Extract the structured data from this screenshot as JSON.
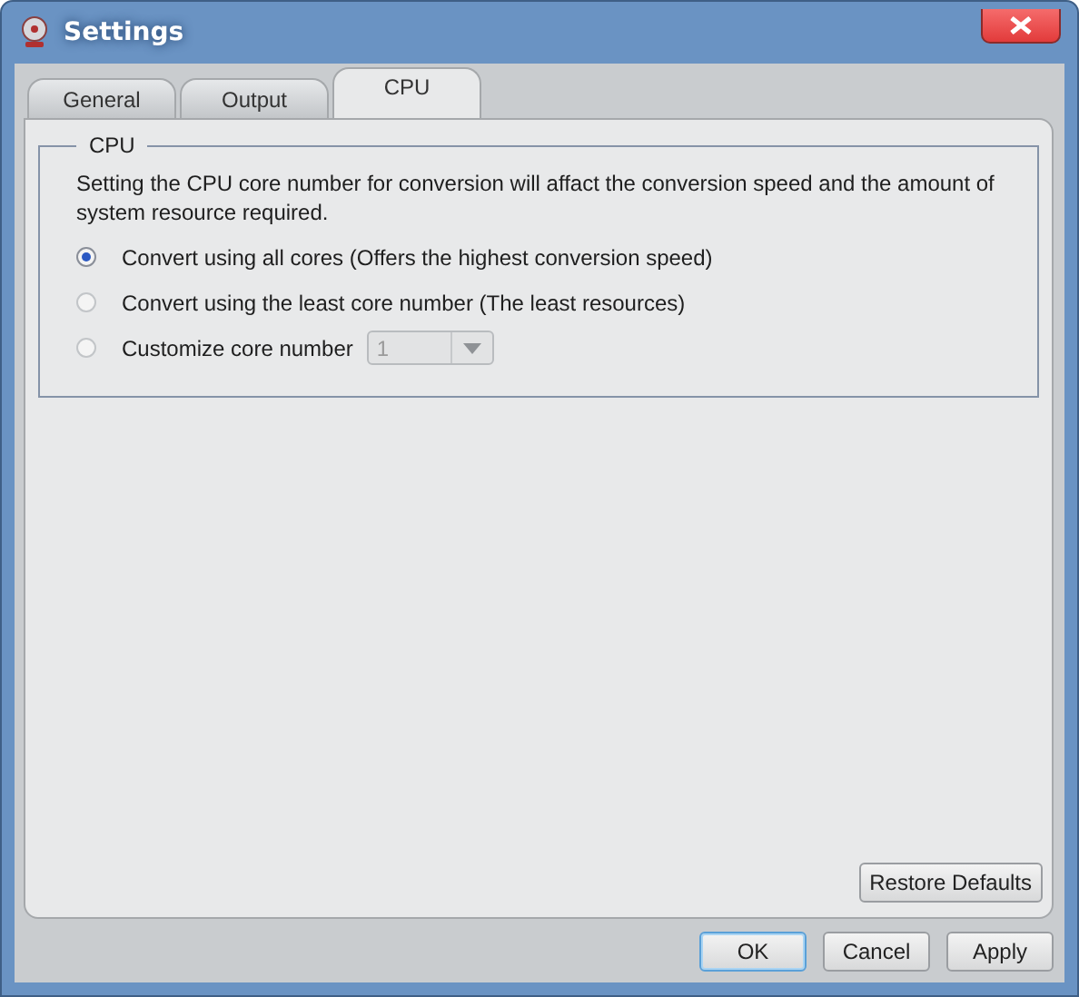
{
  "window": {
    "title": "Settings"
  },
  "tabs": [
    {
      "label": "General",
      "selected": false
    },
    {
      "label": "Output",
      "selected": false
    },
    {
      "label": "CPU",
      "selected": true
    }
  ],
  "group": {
    "title": "CPU",
    "description": "Setting the CPU core number for conversion will affact the conversion  speed and the amount of system resource required.",
    "options": [
      {
        "label": "Convert using all cores (Offers the highest conversion speed)",
        "selected": true
      },
      {
        "label": "Convert using the least core number (The least resources)",
        "selected": false
      },
      {
        "label": "Customize core number",
        "selected": false,
        "dropdown": {
          "value": "1",
          "disabled": true
        }
      }
    ]
  },
  "restore_button": "Restore Defaults",
  "buttons": [
    {
      "label": "OK",
      "default": true
    },
    {
      "label": "Cancel",
      "default": false
    },
    {
      "label": "Apply",
      "default": false
    }
  ]
}
